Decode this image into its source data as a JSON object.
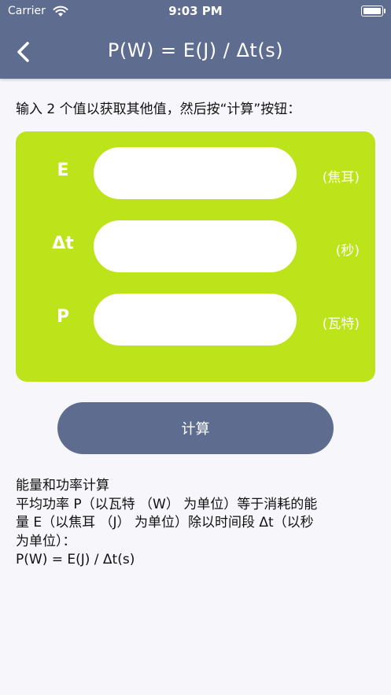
{
  "status_bar": {
    "carrier": "Carrier",
    "time": "9:03 PM",
    "icons": [
      "wifi-icon",
      "battery-icon"
    ]
  },
  "nav": {
    "title": "P(W) = E(J) / Δt(s)",
    "back_icon": "chevron-left-icon"
  },
  "instruction": "输入 2 个值以获取其他值，然后按“计算”按钮：",
  "fields": [
    {
      "label": "E",
      "value": "",
      "unit": "(焦耳)"
    },
    {
      "label": "Δt",
      "value": "",
      "unit": "(秒)"
    },
    {
      "label": "P",
      "value": "",
      "unit": "(瓦特)"
    }
  ],
  "calculate_label": "计算",
  "description": {
    "title": "能量和功率计算",
    "line1": "平均功率 P（以瓦特 （W） 为单位）等于消耗的能",
    "line2": "量 E（以焦耳 （J） 为单位）除以时间段 Δt（以秒",
    "line3": "为单位）：",
    "formula": "P(W) = E(J) / Δt(s)"
  },
  "colors": {
    "primary": "#5d6c8f",
    "card": "#bde31a",
    "background": "#f7f7fb"
  }
}
